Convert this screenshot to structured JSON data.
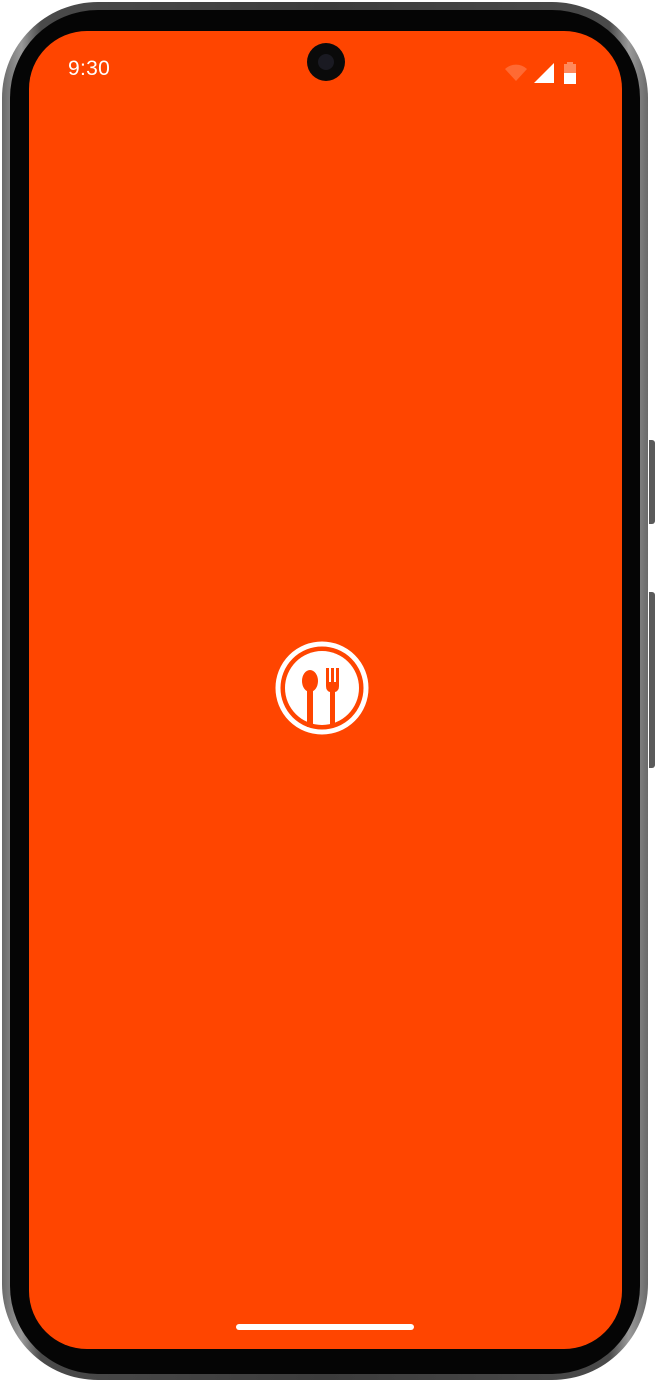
{
  "status_bar": {
    "time": "9:30"
  },
  "theme": {
    "background": "#FF4500",
    "foreground": "#FFFFFF"
  },
  "splash": {
    "logo_icon": "spoon-fork-icon"
  },
  "icons": {
    "wifi": "wifi-icon",
    "signal": "cell-signal-icon",
    "battery": "battery-icon"
  }
}
